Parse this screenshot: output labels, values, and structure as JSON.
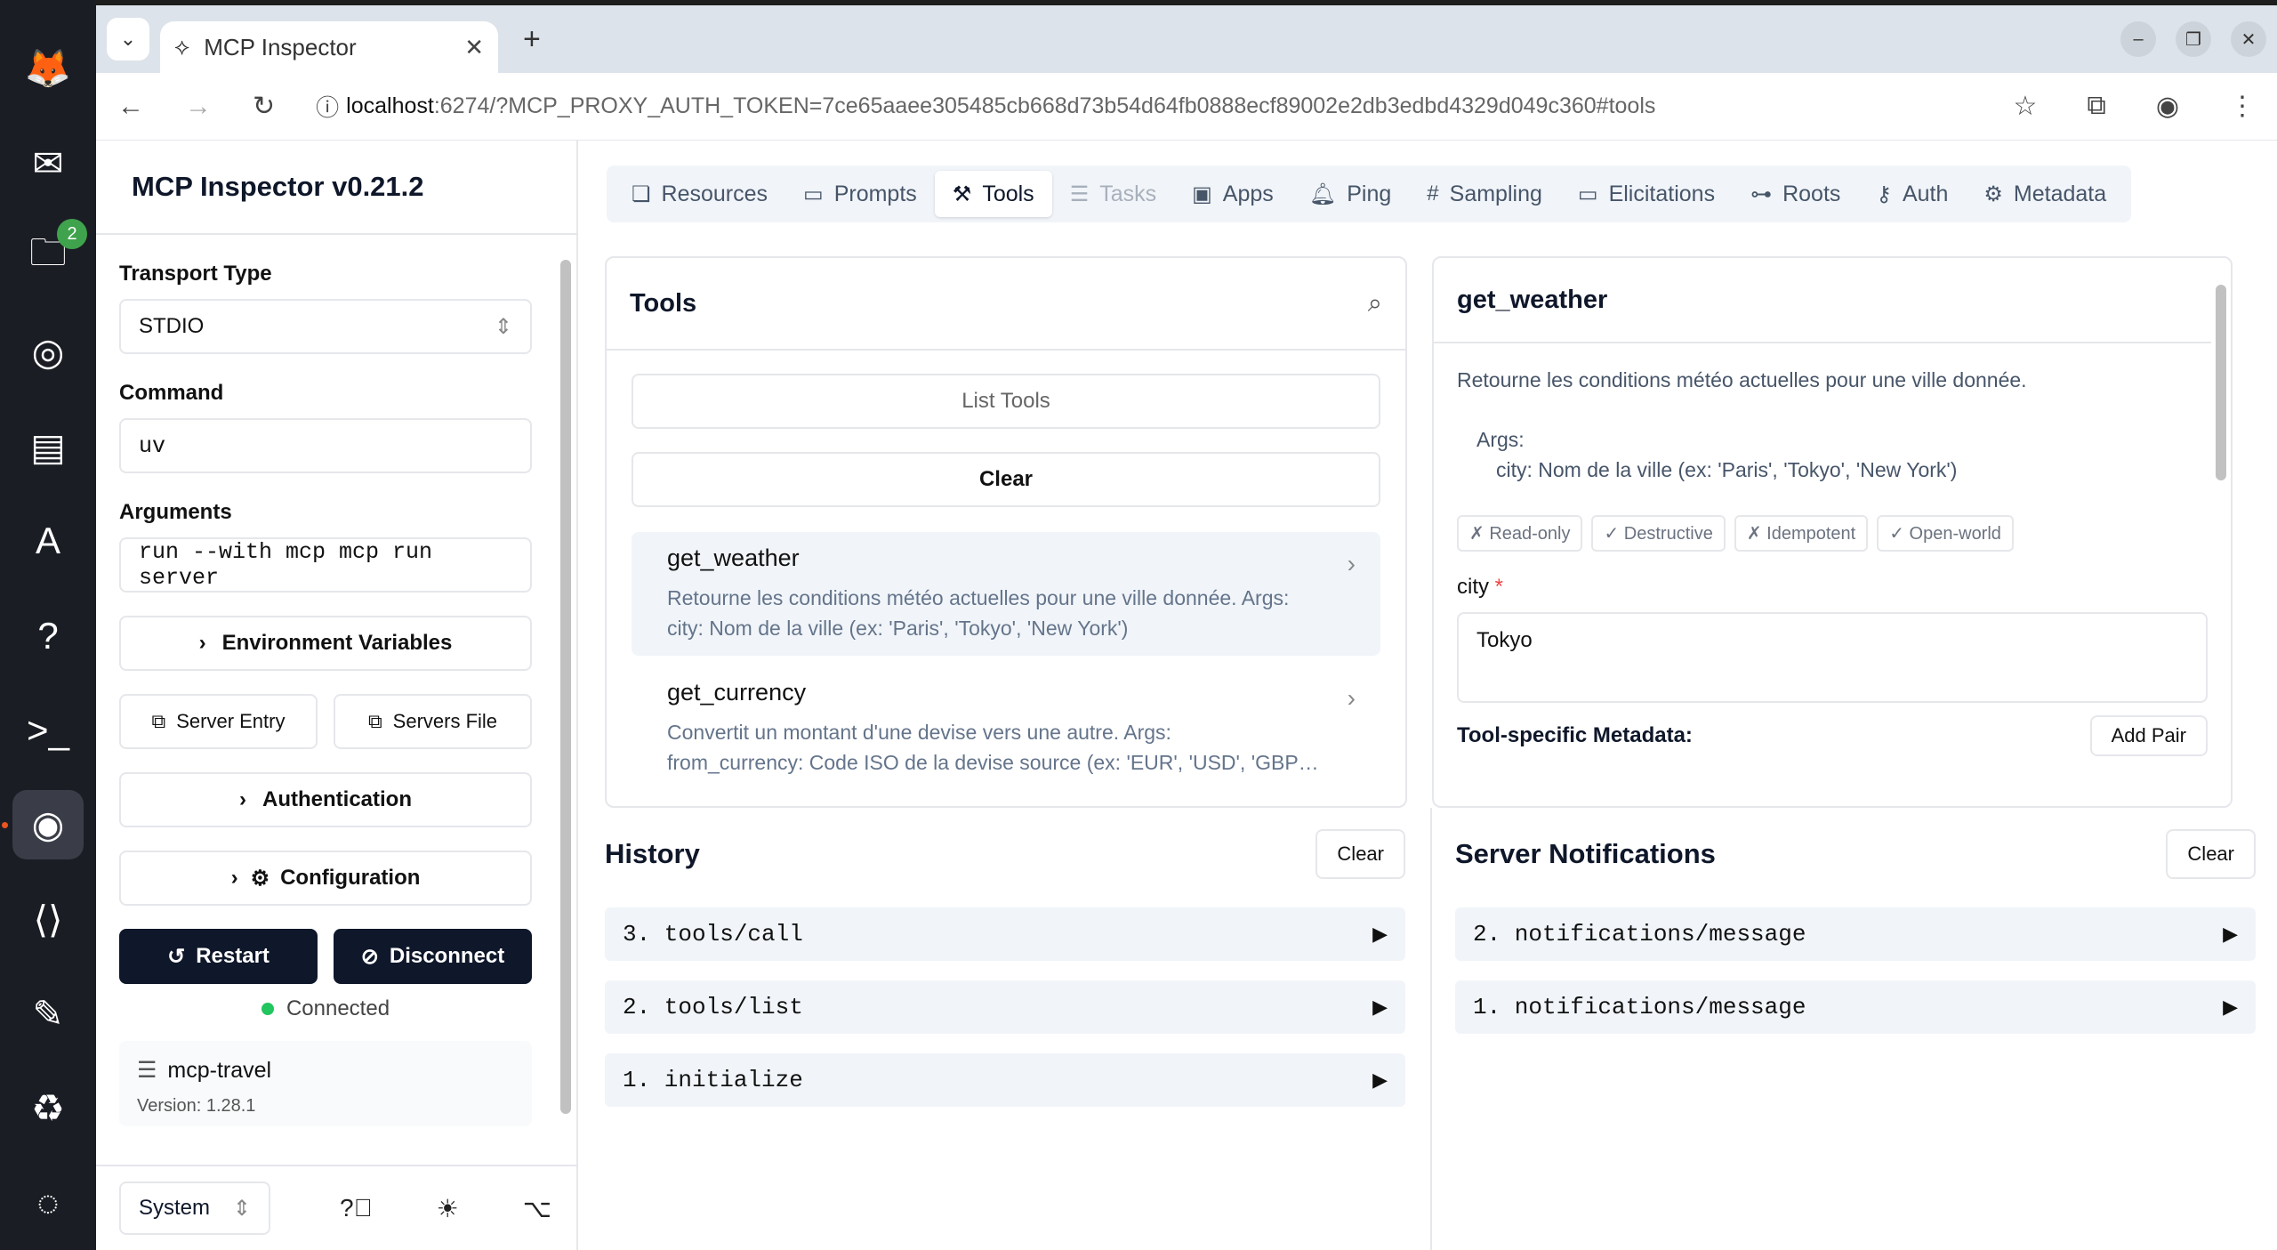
{
  "dock": {
    "files_badge": "2",
    "apps": [
      "firefox-icon",
      "thunderbird-icon",
      "files-icon",
      "rhythmbox-icon",
      "writer-icon",
      "appcenter-icon",
      "help-icon",
      "terminal-icon",
      "chrome-icon",
      "vscode-icon",
      "text-editor-icon",
      "trash-icon",
      "ubuntu-icon"
    ]
  },
  "browser": {
    "tab_title": "MCP Inspector",
    "url_host": "localhost",
    "url_rest": ":6274/?MCP_PROXY_AUTH_TOKEN=7ce65aaee305485cb668d73b54d64fb0888ecf89002e2db3edbd4329d049c360#tools"
  },
  "sidebar": {
    "title": "MCP Inspector v0.21.2",
    "transport_label": "Transport Type",
    "transport_value": "STDIO",
    "command_label": "Command",
    "command_value": "uv",
    "arguments_label": "Arguments",
    "arguments_value": "run --with mcp mcp run server",
    "env_vars": "Environment Variables",
    "server_entry": "Server Entry",
    "servers_file": "Servers File",
    "authentication": "Authentication",
    "configuration": "Configuration",
    "restart": "Restart",
    "disconnect": "Disconnect",
    "status": "Connected",
    "server_name": "mcp-travel",
    "server_version": "Version: 1.28.1",
    "theme": "System"
  },
  "tabs": [
    "Resources",
    "Prompts",
    "Tools",
    "Tasks",
    "Apps",
    "Ping",
    "Sampling",
    "Elicitations",
    "Roots",
    "Auth",
    "Metadata"
  ],
  "tools_panel": {
    "title": "Tools",
    "list_tools": "List Tools",
    "clear": "Clear",
    "items": [
      {
        "name": "get_weather",
        "desc_1": "Retourne les conditions météo actuelles pour une ville donnée. Args:",
        "desc_2": "city: Nom de la ville (ex: 'Paris', 'Tokyo', 'New York')"
      },
      {
        "name": "get_currency",
        "desc_1": "Convertit un montant d'une devise vers une autre. Args:",
        "desc_2": "from_currency: Code ISO de la devise source (ex: 'EUR', 'USD', 'GBP…"
      }
    ]
  },
  "detail_panel": {
    "title": "get_weather",
    "description": "Retourne les conditions météo actuelles pour une ville donnée.",
    "args_label": "Args:",
    "args_line": "city: Nom de la ville (ex: 'Paris', 'Tokyo', 'New York')",
    "annotations": [
      "✗ Read-only",
      "✓ Destructive",
      "✗ Idempotent",
      "✓ Open-world"
    ],
    "param_label": "city",
    "required_mark": "*",
    "param_value": "Tokyo",
    "metadata_label": "Tool-specific Metadata:",
    "add_pair": "Add Pair"
  },
  "history": {
    "title": "History",
    "clear": "Clear",
    "items": [
      "3. tools/call",
      "2. tools/list",
      "1. initialize"
    ]
  },
  "notifications": {
    "title": "Server Notifications",
    "clear": "Clear",
    "items": [
      "2. notifications/message",
      "1. notifications/message"
    ]
  }
}
